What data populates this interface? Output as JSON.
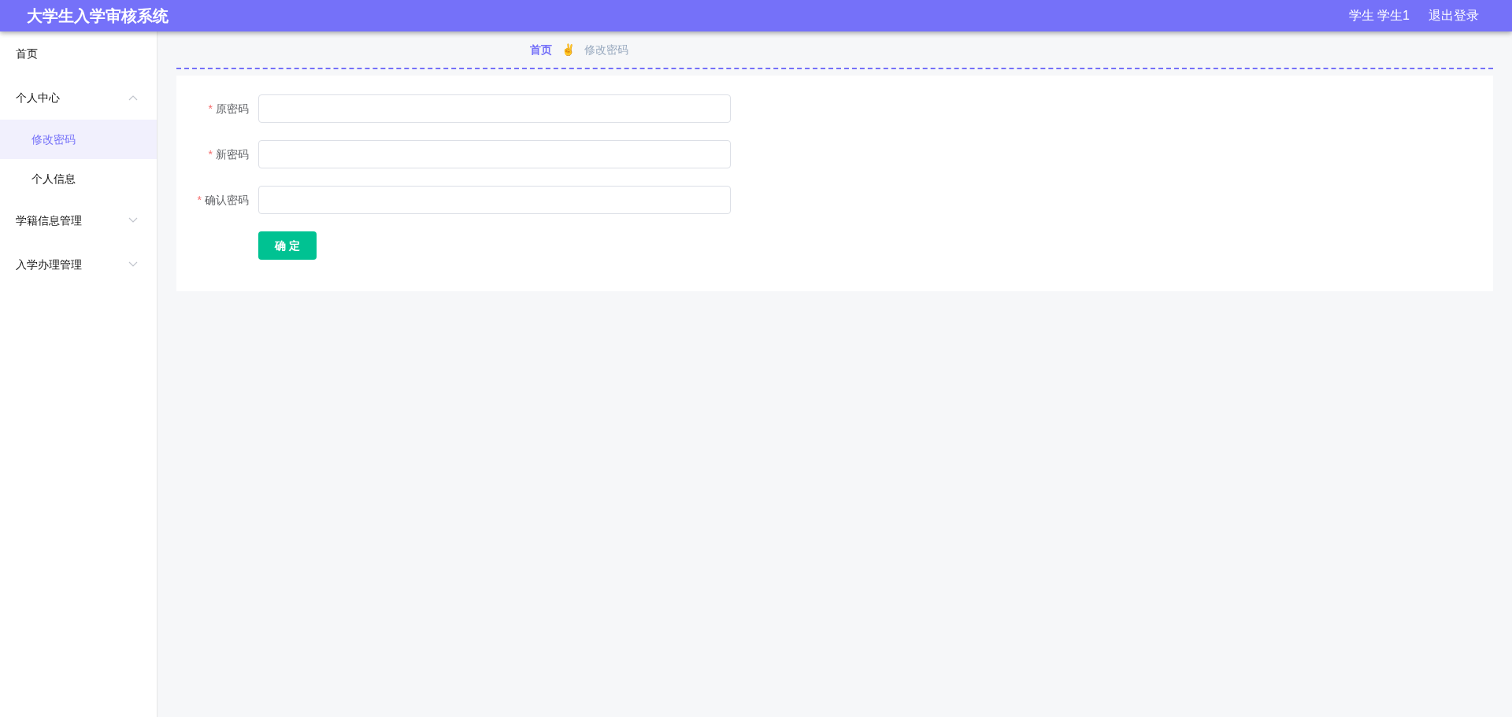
{
  "header": {
    "title": "大学生入学审核系统",
    "user": "学生 学生1",
    "logout": "退出登录"
  },
  "sidebar": {
    "items": [
      {
        "label": "首页",
        "selected": false
      },
      {
        "label": "个人中心",
        "expanded": true,
        "children": [
          {
            "label": "修改密码",
            "selected": true
          },
          {
            "label": "个人信息",
            "selected": false
          }
        ]
      },
      {
        "label": "学籍信息管理",
        "expanded": false
      },
      {
        "label": "入学办理管理",
        "expanded": false
      }
    ]
  },
  "breadcrumb": {
    "home": "首页",
    "separator": "✌",
    "current": "修改密码"
  },
  "form": {
    "fields": [
      {
        "label": "原密码",
        "required_mark": "*"
      },
      {
        "label": "新密码",
        "required_mark": "*"
      },
      {
        "label": "确认密码",
        "required_mark": "*"
      }
    ],
    "submit": "确 定"
  }
}
